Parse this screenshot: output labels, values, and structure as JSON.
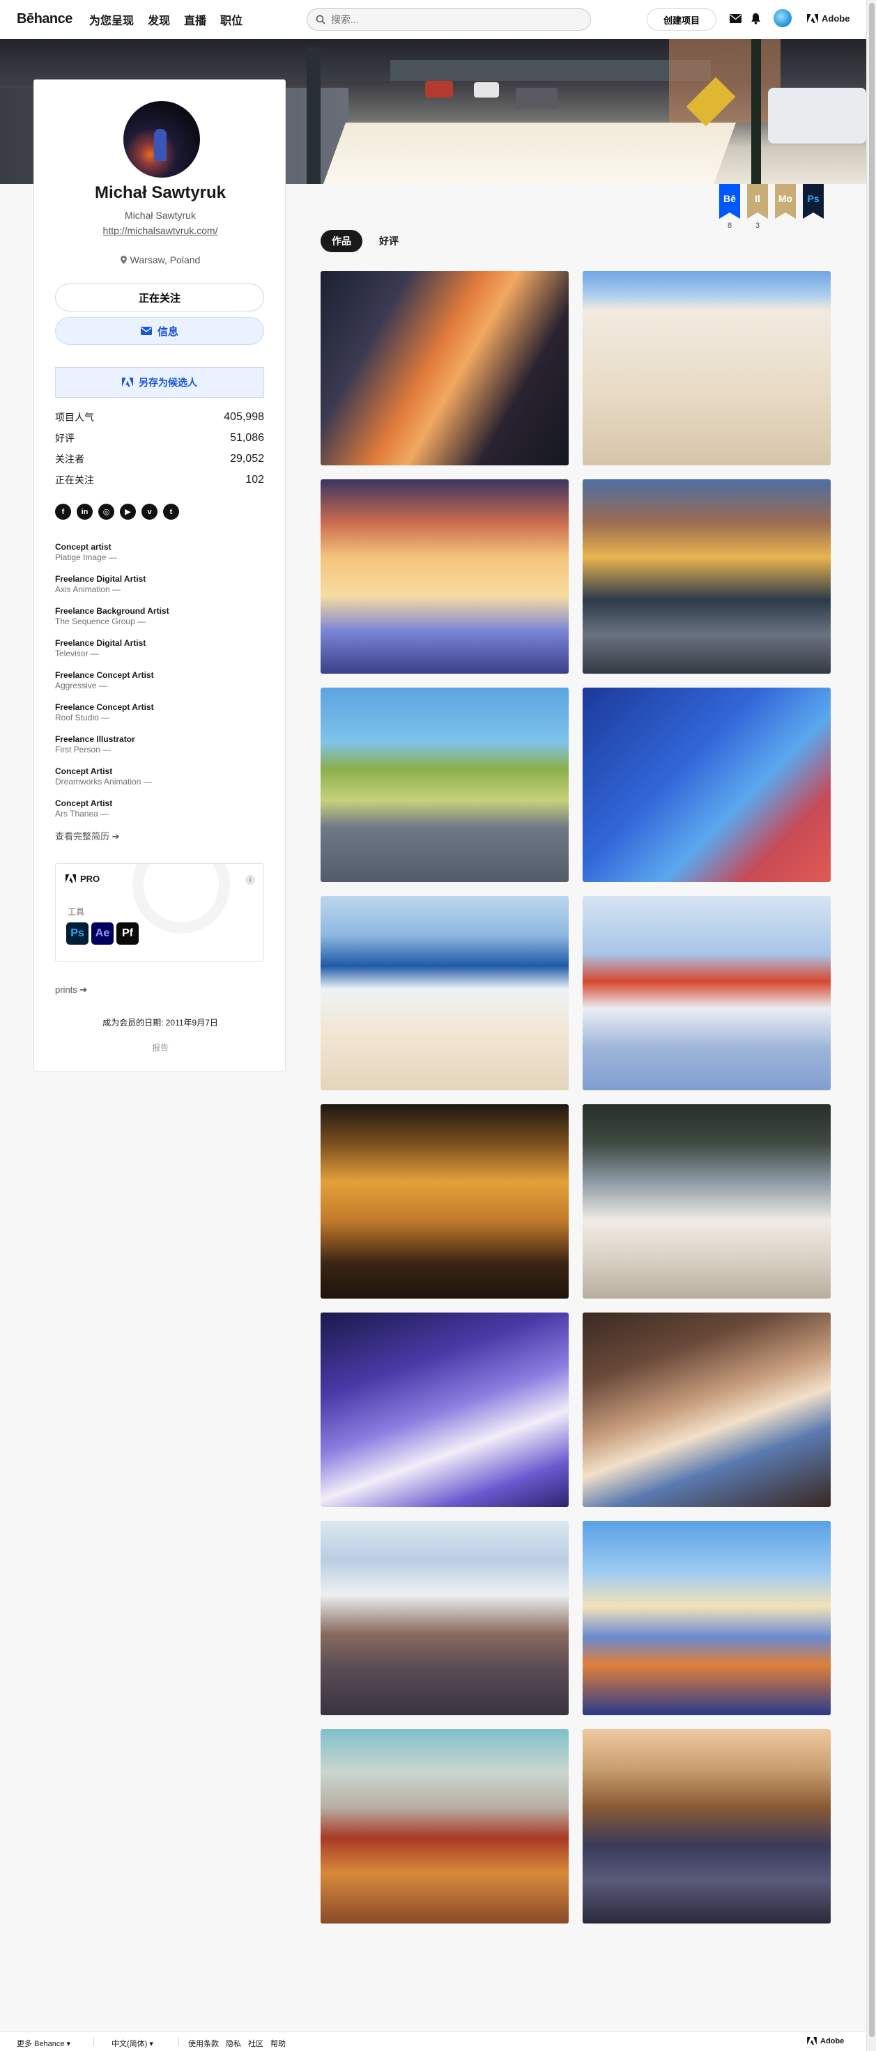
{
  "nav": {
    "logo": "Bēhance",
    "links": [
      "为您呈现",
      "发现",
      "直播",
      "职位"
    ],
    "search_placeholder": "搜索...",
    "create_label": "创建项目",
    "adobe_label": "Adobe"
  },
  "profile": {
    "name": "Michał Sawtyruk",
    "subname": "Michał Sawtyruk",
    "url": "http://michalsawtyruk.com/",
    "location": "Warsaw, Poland",
    "follow_label": "正在关注",
    "message_label": "信息",
    "save_label": "另存为候选人",
    "stats": [
      {
        "label": "项目人气",
        "value": "405,998"
      },
      {
        "label": "好评",
        "value": "51,086"
      },
      {
        "label": "关注者",
        "value": "29,052"
      },
      {
        "label": "正在关注",
        "value": "102"
      }
    ],
    "socials": [
      {
        "icon": "facebook-icon",
        "glyph": "f"
      },
      {
        "icon": "linkedin-icon",
        "glyph": "in"
      },
      {
        "icon": "instagram-icon",
        "glyph": "◎"
      },
      {
        "icon": "youtube-icon",
        "glyph": "▶"
      },
      {
        "icon": "vimeo-icon",
        "glyph": "v"
      },
      {
        "icon": "tumblr-icon",
        "glyph": "t"
      }
    ],
    "jobs": [
      {
        "title": "Concept artist",
        "company": "Platige Image —"
      },
      {
        "title": "Freelance Digital Artist",
        "company": "Axis Animation —"
      },
      {
        "title": "Freelance Background Artist",
        "company": "The Sequence Group —"
      },
      {
        "title": "Freelance Digital Artist",
        "company": "Televisor —"
      },
      {
        "title": "Freelance Concept Artist",
        "company": "Aggressive —"
      },
      {
        "title": "Freelance Concept Artist",
        "company": "Roof Studio —"
      },
      {
        "title": "Freelance Illustrator",
        "company": "First Person —"
      },
      {
        "title": "Concept Artist",
        "company": "Dreamworks Animation —"
      },
      {
        "title": "Concept Artist",
        "company": "Ars Thanea —"
      }
    ],
    "resume_link": "查看完整简历 ➔",
    "pro_label": "PRO",
    "tools_label": "工具",
    "tools": [
      "Ps",
      "Ae",
      "Pf"
    ],
    "prints_link": "prints ➔",
    "member_since": "成为会员的日期: 2011年9月7日",
    "report_label": "报告"
  },
  "badges": [
    {
      "label": "Bē",
      "count": "8",
      "color": "#0057ff"
    },
    {
      "label": "Il",
      "count": "3",
      "color": "#c9ad76"
    },
    {
      "label": "Mo",
      "count": "",
      "color": "#c9ad76"
    },
    {
      "label": "Ps",
      "count": "",
      "color": "#0d1c35"
    }
  ],
  "tabs": {
    "works": "作品",
    "appreciations": "好评"
  },
  "projects": [
    {
      "name": "airplane-cabin",
      "bg": "linear-gradient(120deg,#1b2233 0%,#3b3a52 25%,#e07a3a 45%,#f2a860 55%,#2a2230 75%,#141820 100%)"
    },
    {
      "name": "beach-walker",
      "bg": "linear-gradient(180deg,#6fa6e0 0%,#a9ccef 12%,#f1eadf 20%,#e9dcc6 60%,#d6c5aa 100%)"
    },
    {
      "name": "running-boy",
      "bg": "linear-gradient(180deg,#3a3560 0%,#c96b4e 22%,#f3c47a 40%,#f7dca0 60%,#7a86d6 78%,#3c3f8a 100%)"
    },
    {
      "name": "city-street-cars",
      "bg": "linear-gradient(180deg,#4c6fa3 0%,#9a6c52 22%,#e9b44f 40%,#2c3a4a 62%,#6a7380 80%,#333a44 100%)"
    },
    {
      "name": "suburban-road",
      "bg": "linear-gradient(180deg,#5aa4e0 0%,#7fc3ea 28%,#8ab04a 42%,#c7d17a 58%,#6f7886 72%,#525c6a 100%)"
    },
    {
      "name": "girl-profile",
      "bg": "linear-gradient(135deg,#1b3a9a 0%,#3266d8 40%,#5aa8ee 62%,#c84a56 80%,#e05a52 100%)"
    },
    {
      "name": "beach-girl",
      "bg": "linear-gradient(180deg,#bcd6ee 0%,#8fb8e0 20%,#1f5aa8 36%,#eef2f6 48%,#f2e6d4 70%,#e4d4ba 100%)"
    },
    {
      "name": "gas-station",
      "bg": "linear-gradient(180deg,#d6e4f4 0%,#a7c4e6 30%,#d8472f 44%,#eaeef4 58%,#9fb6da 78%,#7f9ed0 100%)"
    },
    {
      "name": "bathroom",
      "bg": "linear-gradient(180deg,#1c1712 0%,#7a4f1e 20%,#e4a03a 40%,#c17a2a 60%,#3a2414 82%,#1e140c 100%)"
    },
    {
      "name": "elevated-train-street",
      "bg": "linear-gradient(180deg,#27302a 0%,#3e4a42 20%,#8d9aa6 40%,#f0ece4 60%,#d8d0c2 80%,#b8ae9e 100%)"
    },
    {
      "name": "winter-house",
      "bg": "linear-gradient(160deg,#1a1a4a 0%,#4a3aa8 30%,#8a7ee0 50%,#f2eef8 66%,#6a5ad0 84%,#2c2470 100%)"
    },
    {
      "name": "desk-books",
      "bg": "linear-gradient(160deg,#3a2a22 0%,#6a4a3a 25%,#c49a7a 45%,#f2e0c8 58%,#5a7ab0 72%,#3a2822 100%)"
    },
    {
      "name": "hill-street-city",
      "bg": "linear-gradient(180deg,#dce8f2 0%,#b9cde2 20%,#eef0f2 38%,#8a6a5e 58%,#5a4c54 76%,#3a3440 100%)"
    },
    {
      "name": "traveler-suburb",
      "bg": "linear-gradient(180deg,#5aa0e6 0%,#9ccaf2 26%,#f2e2b8 44%,#6a8ad0 60%,#e0803a 74%,#2a3a8a 100%)"
    },
    {
      "name": "burning-farmhouse",
      "bg": "linear-gradient(180deg,#7fc0ca 0%,#c9d6cf 22%,#b8b0a4 40%,#a83a26 56%,#d88a3a 74%,#8a4a2a 100%)"
    },
    {
      "name": "old-town-square",
      "bg": "linear-gradient(180deg,#f0c8a0 0%,#c9a070 20%,#8a5a34 40%,#3a3a5a 60%,#5a5a7a 78%,#2a2a3a 100%)"
    }
  ],
  "footer": {
    "more": "更多 Behance",
    "lang": "中文(简体)",
    "links": [
      "使用条款",
      "隐私",
      "社区",
      "帮助"
    ],
    "adobe": "Adobe"
  }
}
